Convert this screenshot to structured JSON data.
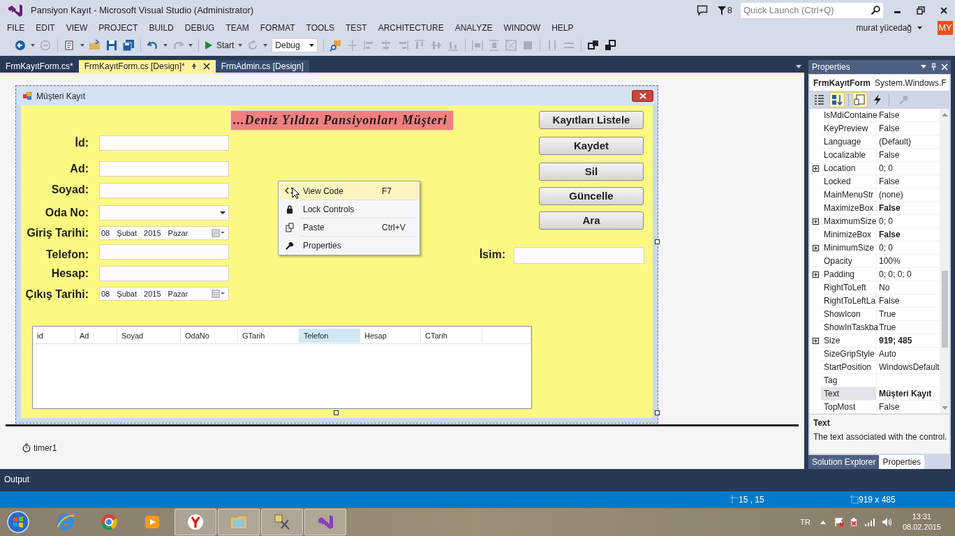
{
  "window": {
    "title": "Pansiyon Kayıt - Microsoft Visual Studio (Administrator)",
    "notification_count": "8",
    "quick_launch_placeholder": "Quick Launch (Ctrl+Q)"
  },
  "menu": [
    "FILE",
    "EDIT",
    "VIEW",
    "PROJECT",
    "BUILD",
    "DEBUG",
    "TEAM",
    "FORMAT",
    "TOOLS",
    "TEST",
    "ARCHITECTURE",
    "ANALYZE",
    "WINDOW",
    "HELP"
  ],
  "user": {
    "name": "murat yücedağ",
    "initials": "MY"
  },
  "toolbar": {
    "start_label": "Start",
    "configuration": "Debug"
  },
  "doc_tabs": [
    {
      "label": "FrmKayıtForm.cs*",
      "selected": false
    },
    {
      "label": "FrmKayıtForm.cs [Design]*",
      "selected": true
    },
    {
      "label": "FrmAdmin.cs [Design]",
      "selected": false
    }
  ],
  "form": {
    "title": "Müşteri Kayıt",
    "header": "...Deniz Yıldızı Pansiyonları Müşteri",
    "fields": [
      {
        "label": "İd:",
        "kind": "text"
      },
      {
        "label": "Ad:",
        "kind": "text"
      },
      {
        "label": "Soyad:",
        "kind": "text"
      },
      {
        "label": "Oda No:",
        "kind": "combo"
      },
      {
        "label": "Giriş Tarihi:",
        "kind": "date",
        "value": "08 Şubat 2015 Pazar"
      },
      {
        "label": "Telefon:",
        "kind": "text"
      },
      {
        "label": "Hesap:",
        "kind": "text"
      },
      {
        "label": "Çıkış Tarihi:",
        "kind": "date",
        "value": "08 Şubat 2015 Pazar"
      }
    ],
    "buttons": [
      "Kayıtları Listele",
      "Kaydet",
      "Sil",
      "Güncelle",
      "Ara"
    ],
    "search_label": "İsim:",
    "grid_columns": [
      {
        "label": "id",
        "selected": false
      },
      {
        "label": "Ad",
        "selected": false
      },
      {
        "label": "Soyad",
        "selected": false
      },
      {
        "label": "OdaNo",
        "selected": false
      },
      {
        "label": "GTarih",
        "selected": false
      },
      {
        "label": "Telefon",
        "selected": true
      },
      {
        "label": "Hesap",
        "selected": false
      },
      {
        "label": "CTarih",
        "selected": false
      }
    ]
  },
  "context_menu": [
    {
      "kind": "code",
      "label": "View Code",
      "shortcut": "F7",
      "selected": true
    },
    {
      "kind": "lock",
      "label": "Lock Controls",
      "selected": false
    },
    {
      "kind": "paste",
      "label": "Paste",
      "shortcut": "Ctrl+V",
      "selected": false
    },
    {
      "kind": "wrench",
      "label": "Properties",
      "selected": false
    }
  ],
  "component_tray": [
    {
      "label": "timer1"
    }
  ],
  "properties": {
    "title": "Properties",
    "object_name": "FrmKayıtForm",
    "object_type": "System.Windows.F",
    "view_buttons": [
      {
        "kind": "categorized",
        "selected": false
      },
      {
        "kind": "alphabetical",
        "selected": true
      },
      {
        "kind": "properties",
        "selected": true
      },
      {
        "kind": "events",
        "selected": false
      }
    ],
    "rows": [
      {
        "name": "IsMdiContaine",
        "value": "False",
        "expandable": false,
        "modified": false,
        "selected": false
      },
      {
        "name": "KeyPreview",
        "value": "False",
        "expandable": false,
        "modified": false,
        "selected": false
      },
      {
        "name": "Language",
        "value": "(Default)",
        "expandable": false,
        "modified": false,
        "selected": false
      },
      {
        "name": "Localizable",
        "value": "False",
        "expandable": false,
        "modified": false,
        "selected": false
      },
      {
        "name": "Location",
        "value": "0; 0",
        "expandable": true,
        "modified": false,
        "selected": false
      },
      {
        "name": "Locked",
        "value": "False",
        "expandable": false,
        "modified": false,
        "selected": false
      },
      {
        "name": "MainMenuStr",
        "value": "(none)",
        "expandable": false,
        "modified": false,
        "selected": false
      },
      {
        "name": "MaximizeBox",
        "value": "False",
        "expandable": false,
        "modified": true,
        "selected": false
      },
      {
        "name": "MaximumSize",
        "value": "0; 0",
        "expandable": true,
        "modified": false,
        "selected": false
      },
      {
        "name": "MinimizeBox",
        "value": "False",
        "expandable": false,
        "modified": true,
        "selected": false
      },
      {
        "name": "MinimumSize",
        "value": "0; 0",
        "expandable": true,
        "modified": false,
        "selected": false
      },
      {
        "name": "Opacity",
        "value": "100%",
        "expandable": false,
        "modified": false,
        "selected": false
      },
      {
        "name": "Padding",
        "value": "0; 0; 0; 0",
        "expandable": true,
        "modified": false,
        "selected": false
      },
      {
        "name": "RightToLeft",
        "value": "No",
        "expandable": false,
        "modified": false,
        "selected": false
      },
      {
        "name": "RightToLeftLa",
        "value": "False",
        "expandable": false,
        "modified": false,
        "selected": false
      },
      {
        "name": "ShowIcon",
        "value": "True",
        "expandable": false,
        "modified": false,
        "selected": false
      },
      {
        "name": "ShowInTaskba",
        "value": "True",
        "expandable": false,
        "modified": false,
        "selected": false
      },
      {
        "name": "Size",
        "value": "919; 485",
        "expandable": true,
        "modified": true,
        "selected": false
      },
      {
        "name": "SizeGripStyle",
        "value": "Auto",
        "expandable": false,
        "modified": false,
        "selected": false
      },
      {
        "name": "StartPosition",
        "value": "WindowsDefault",
        "expandable": false,
        "modified": false,
        "selected": false
      },
      {
        "name": "Tag",
        "expandable": false,
        "selected": false
      },
      {
        "name": "Text",
        "value": "Müşteri Kayıt",
        "expandable": false,
        "modified": true,
        "selected": true
      },
      {
        "name": "TopMost",
        "value": "False",
        "expandable": false,
        "modified": false,
        "selected": false
      }
    ],
    "description_title": "Text",
    "description": "The text associated with the control.",
    "tabs": [
      {
        "label": "Solution Explorer",
        "selected": false
      },
      {
        "label": "Properties",
        "selected": true
      }
    ]
  },
  "output_label": "Output",
  "status_bar": {
    "position": "15 , 15",
    "size": "919 x 485"
  },
  "taskbar": {
    "apps": [
      {
        "kind": "ie",
        "active": false
      },
      {
        "kind": "chrome",
        "active": false
      },
      {
        "kind": "media",
        "active": false
      },
      {
        "kind": "yandex",
        "active": true
      },
      {
        "kind": "explorer",
        "active": true
      },
      {
        "kind": "tool",
        "active": true
      },
      {
        "kind": "vs",
        "active": true
      }
    ],
    "language": "TR",
    "time": "13:31",
    "date": "08.02.2015"
  }
}
